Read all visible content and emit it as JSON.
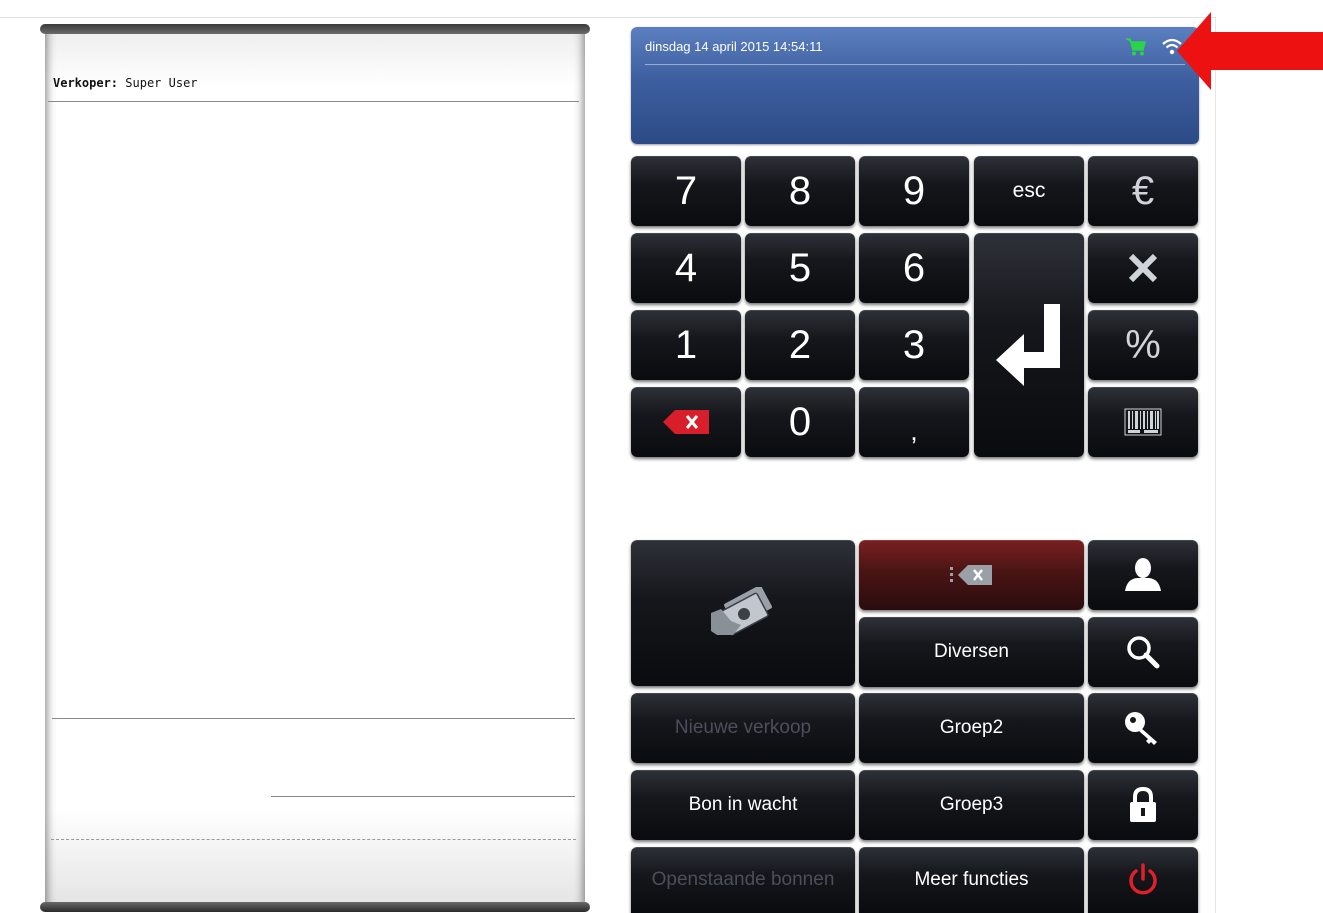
{
  "receipt": {
    "seller_label": "Verkoper:",
    "seller_name": "Super User"
  },
  "display": {
    "datetime": "dinsdag 14 april 2015 14:54:11",
    "status_icons": [
      "cart-icon",
      "wifi-icon"
    ],
    "accent_color": "#3e5f9f"
  },
  "numpad": {
    "k7": "7",
    "k8": "8",
    "k9": "9",
    "k4": "4",
    "k5": "5",
    "k6": "6",
    "k1": "1",
    "k2": "2",
    "k3": "3",
    "k0": "0",
    "comma": ",",
    "esc": "esc",
    "euro": "€",
    "percent": "%",
    "icons": [
      "backspace-icon",
      "enter-icon",
      "multiply-icon",
      "barcode-icon"
    ]
  },
  "functions": {
    "diversen": "Diversen",
    "nieuwe_verkoop": "Nieuwe verkoop",
    "groep2": "Groep2",
    "bon_in_wacht": "Bon in wacht",
    "groep3": "Groep3",
    "openstaande_bonnen": "Openstaande bonnen",
    "meer_functies": "Meer functies",
    "icons": [
      "payment-icon",
      "void-tag-icon",
      "user-icon",
      "search-icon",
      "key-icon",
      "lock-icon",
      "power-icon"
    ]
  },
  "annotation": {
    "arrow_color": "#ee1111"
  }
}
